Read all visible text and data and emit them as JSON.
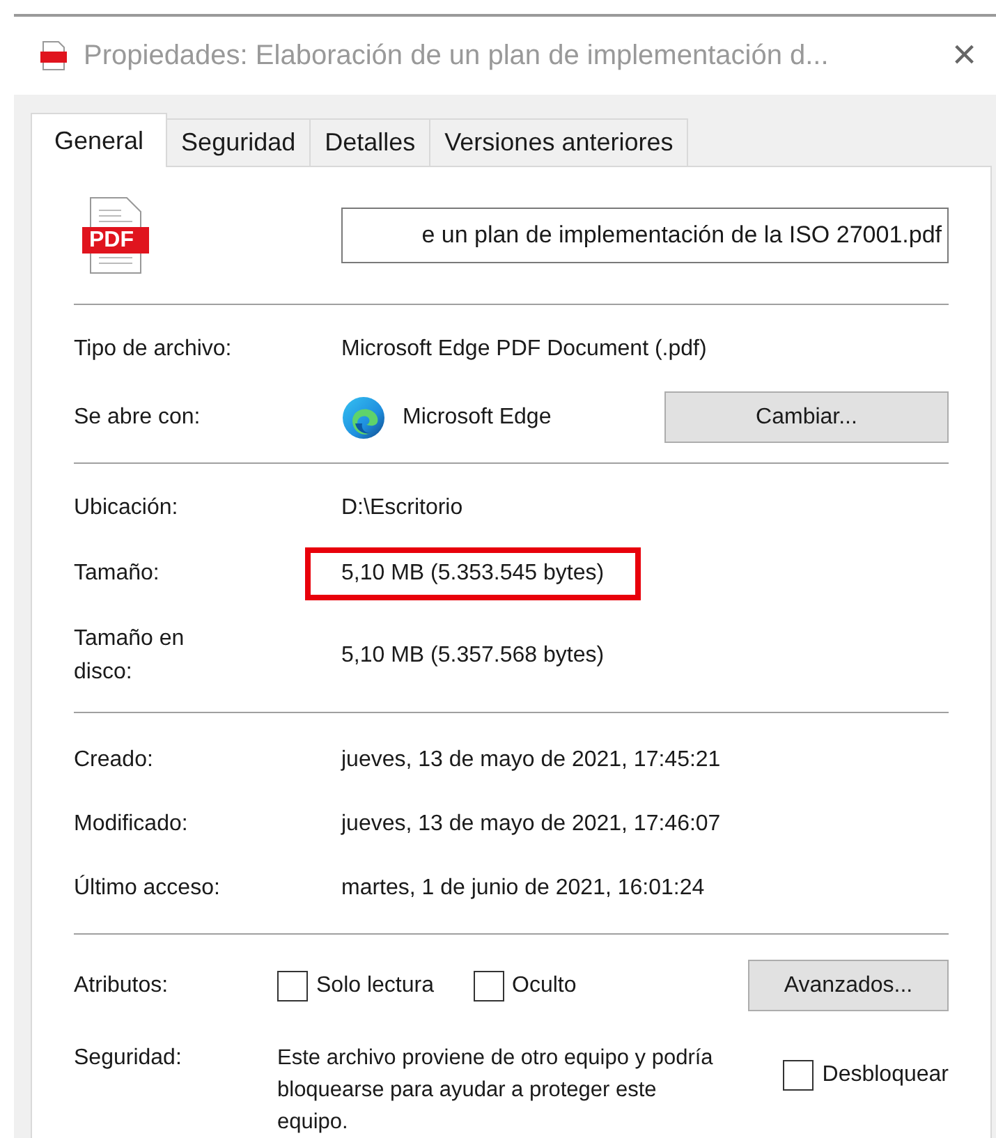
{
  "window": {
    "title": "Propiedades: Elaboración de un plan de implementación d...",
    "close": "×"
  },
  "tabs": [
    {
      "label": "General",
      "selected": true
    },
    {
      "label": "Seguridad",
      "selected": false
    },
    {
      "label": "Detalles",
      "selected": false
    },
    {
      "label": "Versiones anteriores",
      "selected": false
    }
  ],
  "file": {
    "icon_label": "PDF",
    "name": "e un plan de implementación de la ISO 27001.pdf"
  },
  "type_section": [
    {
      "kind": "text",
      "label": "Tipo de archivo:",
      "value": "Microsoft Edge PDF Document (.pdf)"
    },
    {
      "kind": "app",
      "label": "Se abre con:",
      "value": "Microsoft Edge",
      "button": "Cambiar..."
    }
  ],
  "location_section": [
    {
      "label": "Ubicación:",
      "value": "D:\\Escritorio",
      "highlighted": false
    },
    {
      "label": "Tamaño:",
      "value": "5,10 MB (5.353.545 bytes)",
      "highlighted": true
    },
    {
      "label": "Tamaño en disco:",
      "value": "5,10 MB (5.357.568 bytes)",
      "highlighted": false
    }
  ],
  "dates_section": [
    {
      "label": "Creado:",
      "value": "jueves, 13 de mayo de 2021, 17:45:21"
    },
    {
      "label": "Modificado:",
      "value": "jueves, 13 de mayo de 2021, 17:46:07"
    },
    {
      "label": "Último acceso:",
      "value": "martes, 1 de junio de 2021, 16:01:24"
    }
  ],
  "attributes": {
    "label": "Atributos:",
    "checkboxes": [
      {
        "label": "Solo lectura",
        "checked": false
      },
      {
        "label": "Oculto",
        "checked": false
      }
    ],
    "button": "Avanzados..."
  },
  "security": {
    "label": "Seguridad:",
    "text": "Este archivo proviene de otro equipo y podría bloquearse para ayudar a proteger este equipo.",
    "checkbox": {
      "label": "Desbloquear",
      "checked": false
    }
  }
}
